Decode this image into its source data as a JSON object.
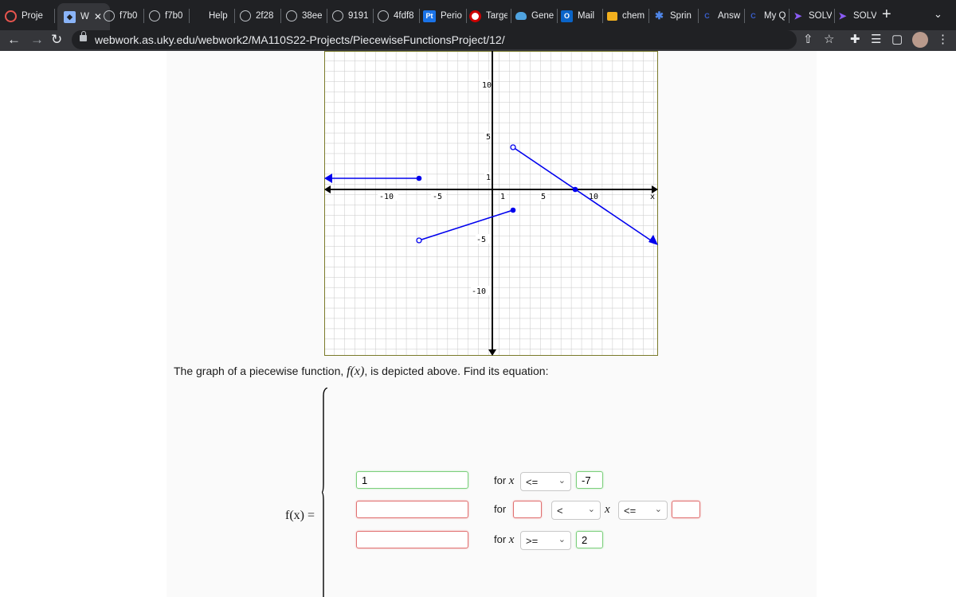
{
  "browser": {
    "tabs": [
      {
        "label": "Proje",
        "icon": "webwork-icon",
        "color": "#e8554e"
      },
      {
        "label": "W",
        "icon": "webwork-icon",
        "color": "#8ab4f8"
      },
      {
        "label": "f7b0",
        "icon": "chatgpt-icon",
        "color": "#bdc1c6"
      },
      {
        "label": "f7b0",
        "icon": "chatgpt-icon",
        "color": "#bdc1c6"
      },
      {
        "label": "Help",
        "icon": "blank-icon",
        "color": "#5f6368"
      },
      {
        "label": "2f28",
        "icon": "chatgpt-icon",
        "color": "#bdc1c6"
      },
      {
        "label": "38ee",
        "icon": "chatgpt-icon",
        "color": "#bdc1c6"
      },
      {
        "label": "9191",
        "icon": "chatgpt-icon",
        "color": "#bdc1c6"
      },
      {
        "label": "4fdf8",
        "icon": "chatgpt-icon",
        "color": "#bdc1c6"
      },
      {
        "label": "Perio",
        "icon": "periodic-table-icon",
        "color": "#1a73e8"
      },
      {
        "label": "Targe",
        "icon": "target-icon",
        "color": "#cc0000"
      },
      {
        "label": "Gene",
        "icon": "cloud-icon",
        "color": "#4fa3e0"
      },
      {
        "label": "Mail",
        "icon": "outlook-icon",
        "color": "#0a64c8"
      },
      {
        "label": "chem",
        "icon": "home-icon",
        "color": "#f2b01e"
      },
      {
        "label": "Sprin",
        "icon": "sprint-icon",
        "color": "#4f86e8"
      },
      {
        "label": "Answ",
        "icon": "answers-icon",
        "color": "#3a5fcd"
      },
      {
        "label": "My Q",
        "icon": "answers-icon",
        "color": "#3a5fcd"
      },
      {
        "label": "SOLV",
        "icon": "solver-icon",
        "color": "#8b5cf6"
      },
      {
        "label": "SOLV",
        "icon": "solver-icon",
        "color": "#8b5cf6"
      }
    ],
    "close_glyph": "✕",
    "new_tab": "+",
    "url": "webwork.as.uky.edu/webwork2/MA110S22-Projects/PiecewiseFunctionsProject/12/"
  },
  "graph": {
    "y_ticks": [
      "10",
      "5",
      "1",
      "-5",
      "-10"
    ],
    "x_ticks": [
      "-10",
      "-5",
      "1",
      "5",
      "10"
    ],
    "x_axis_label": "x"
  },
  "problem": {
    "text_before": "The graph of a piecewise function, ",
    "fn": "f(x)",
    "text_after": ", is depicted above. Find its equation:",
    "fx_label": "f(x) ="
  },
  "rows": [
    {
      "expr": "1",
      "expr_status": "correct",
      "for_label": "for",
      "show_x": true,
      "op1": "<=",
      "val1": "-7",
      "val1_status": "correct"
    },
    {
      "expr": "",
      "expr_status": "incorrect",
      "for_label": "for",
      "show_x": false,
      "left_val": "",
      "op1": "<",
      "x_var": "x",
      "op2": "<=",
      "right_val": ""
    },
    {
      "expr": "",
      "expr_status": "incorrect",
      "for_label": "for",
      "show_x": true,
      "op1": ">=",
      "val1": "2",
      "val1_status": "correct"
    }
  ],
  "colors": {
    "accent": "#0000ee",
    "correct_border": "#7ccf7c",
    "incorrect_border": "#e17171"
  }
}
